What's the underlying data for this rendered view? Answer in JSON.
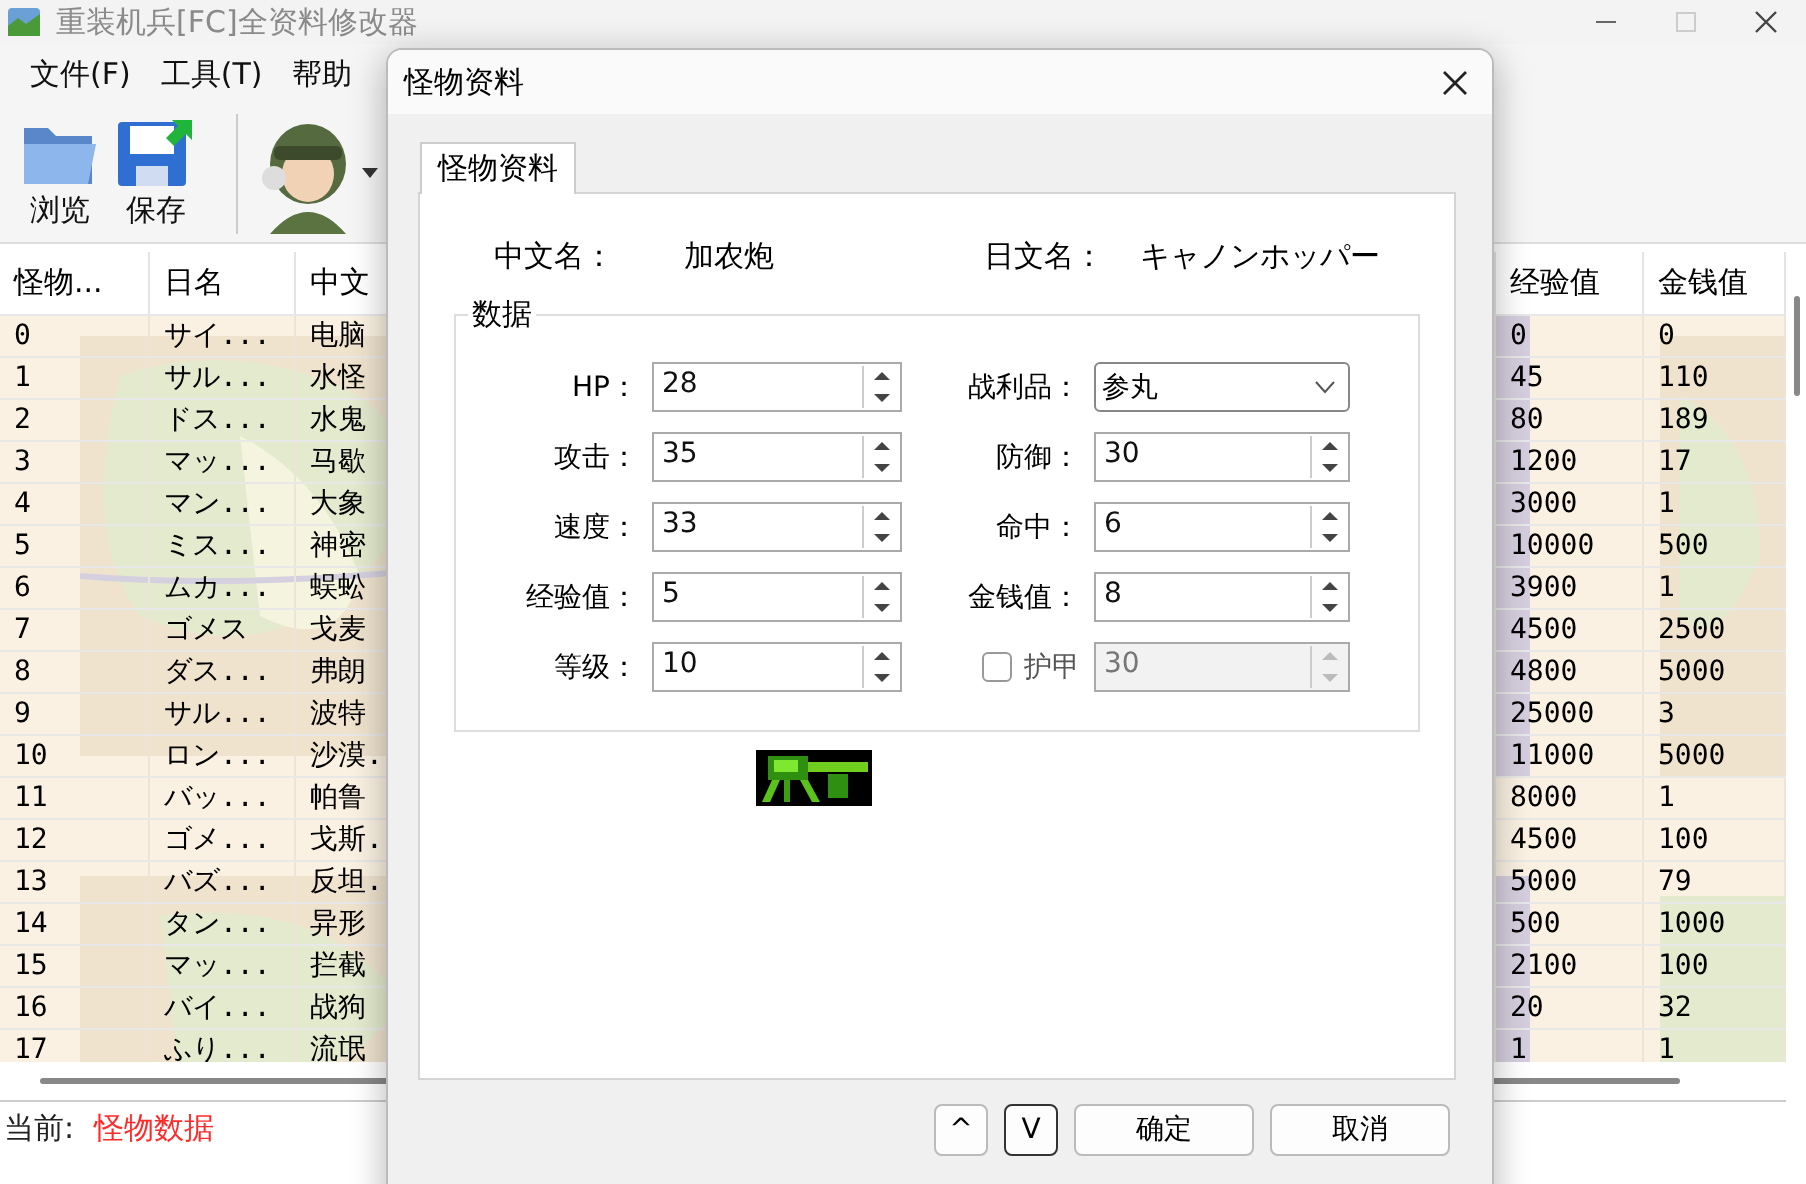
{
  "window": {
    "title": "重装机兵[FC]全资料修改器"
  },
  "menu": [
    {
      "label": "文件(F)"
    },
    {
      "label": "工具(T)"
    },
    {
      "label": "帮助"
    }
  ],
  "toolbar": [
    {
      "kind": "folder",
      "label": "浏览"
    },
    {
      "kind": "save",
      "label": "保存"
    },
    {
      "kind": "avatar"
    }
  ],
  "table": {
    "columns": [
      "怪物...",
      "日名",
      "中文",
      "经验值",
      "金钱值"
    ],
    "rows": [
      [
        "0",
        "サイ...",
        "电脑",
        "0",
        "0"
      ],
      [
        "1",
        "サル...",
        "水怪",
        "45",
        "110"
      ],
      [
        "2",
        "ドス...",
        "水鬼",
        "80",
        "189"
      ],
      [
        "3",
        "マッ...",
        "马歇",
        "1200",
        "17"
      ],
      [
        "4",
        "マン...",
        "大象",
        "3000",
        "1"
      ],
      [
        "5",
        "ミス...",
        "神密",
        "10000",
        "500"
      ],
      [
        "6",
        "ムカ...",
        "蜈蚣",
        "3900",
        "1"
      ],
      [
        "7",
        "ゴメス",
        "戈麦",
        "4500",
        "2500"
      ],
      [
        "8",
        "ダス...",
        "弗朗",
        "4800",
        "5000"
      ],
      [
        "9",
        "サル...",
        "波特",
        "25000",
        "3"
      ],
      [
        "10",
        "ロン...",
        "沙漠.",
        "11000",
        "5000"
      ],
      [
        "11",
        "バッ...",
        "帕鲁",
        "8000",
        "1"
      ],
      [
        "12",
        "ゴメ...",
        "戈斯.",
        "4500",
        "100"
      ],
      [
        "13",
        "バズ...",
        "反坦.",
        "5000",
        "79"
      ],
      [
        "14",
        "タン...",
        "异形",
        "500",
        "1000"
      ],
      [
        "15",
        "マッ...",
        "拦截",
        "2100",
        "100"
      ],
      [
        "16",
        "バイ...",
        "战狗",
        "20",
        "32"
      ],
      [
        "17",
        "ふり...",
        "流氓",
        "1",
        "1"
      ]
    ]
  },
  "status_bar": {
    "label": "当前:",
    "value": "怪物数据"
  },
  "dialog": {
    "title": "怪物资料",
    "tabs": [
      {
        "label": "怪物资料",
        "selected": true
      }
    ],
    "names": [
      {
        "label": "中文名：",
        "value": "加农炮"
      },
      {
        "label": "日文名：",
        "value": "キャノンホッパー"
      }
    ],
    "group": "数据",
    "fields": [
      {
        "label": "HP：",
        "value": "28",
        "kind": "spin"
      },
      {
        "label": "战利品：",
        "value": "参丸",
        "kind": "combo"
      },
      {
        "label": "攻击：",
        "value": "35",
        "kind": "spin"
      },
      {
        "label": "防御：",
        "value": "30",
        "kind": "spin"
      },
      {
        "label": "速度：",
        "value": "33",
        "kind": "spin"
      },
      {
        "label": "命中：",
        "value": "6",
        "kind": "spin"
      },
      {
        "label": "经验值：",
        "value": "5",
        "kind": "spin"
      },
      {
        "label": "金钱值：",
        "value": "8",
        "kind": "spin"
      },
      {
        "label": "等级：",
        "value": "10",
        "kind": "spin"
      },
      {
        "label": "护甲",
        "value": "30",
        "kind": "check_spin",
        "checked": false
      }
    ],
    "buttons": [
      {
        "label": "^",
        "kind": "small"
      },
      {
        "label": "V",
        "kind": "small"
      },
      {
        "label": "确定",
        "kind": "wide"
      },
      {
        "label": "取消",
        "kind": "wide"
      }
    ]
  }
}
